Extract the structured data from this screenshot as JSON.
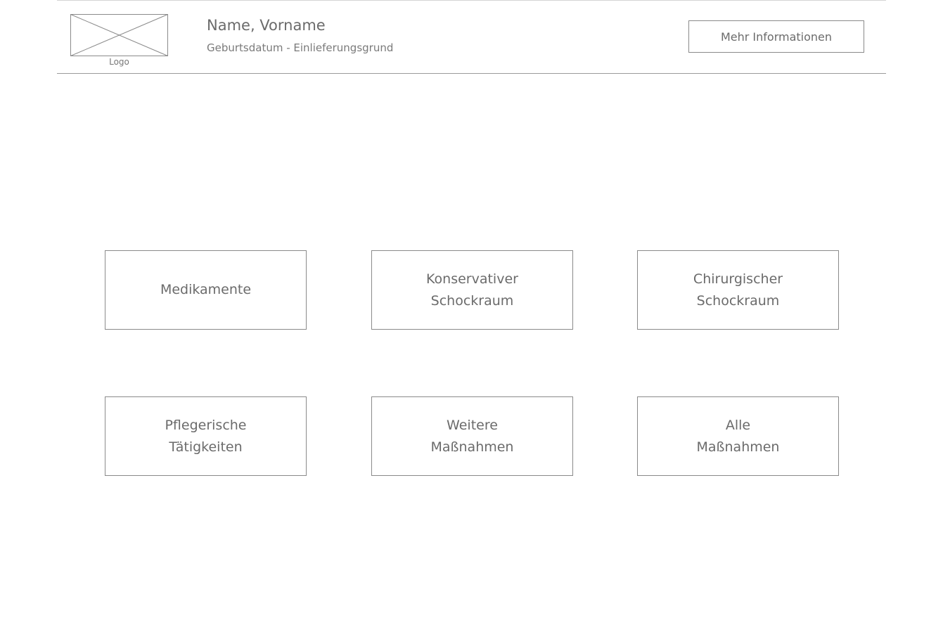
{
  "header": {
    "logo_label": "Logo",
    "patient_name": "Name, Vorname",
    "patient_subtitle": "Geburtsdatum - Einlieferungsgrund",
    "more_info_label": "Mehr Informationen"
  },
  "tiles": [
    {
      "label": "Medikamente"
    },
    {
      "label": "Konservativer\nSchockraum"
    },
    {
      "label": "Chirurgischer\nSchockraum"
    },
    {
      "label": "Pflegerische\nTätigkeiten"
    },
    {
      "label": "Weitere\nMaßnahmen"
    },
    {
      "label": "Alle\nMaßnahmen"
    }
  ],
  "colors": {
    "border": "#8a8a8a",
    "text": "#6b6b6b",
    "background": "#ffffff"
  }
}
